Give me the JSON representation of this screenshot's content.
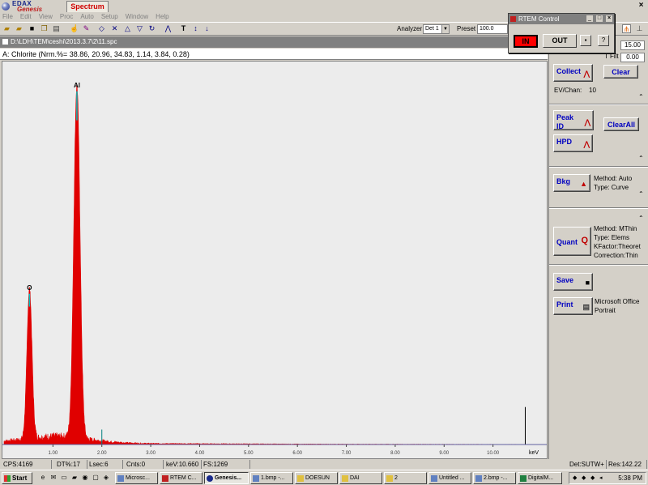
{
  "app": {
    "logo_top": "EDAX",
    "logo_bottom": "Genesis",
    "tab": "Spectrum",
    "close_glyph": "×"
  },
  "menu": [
    "File",
    "Edit",
    "View",
    "Proc",
    "Auto",
    "Setup",
    "Window",
    "Help"
  ],
  "toolbar": {
    "icons": [
      "open-icon",
      "import-icon",
      "save-icon",
      "copy-icon",
      "print-icon",
      "hand-icon",
      "marker-icon",
      "expand-h-icon",
      "contract-h-icon",
      "expand-v-icon",
      "contract-v-icon",
      "reset-icon",
      "peak-icon",
      "text-icon",
      "label-arrow-icon"
    ],
    "analyzer_label": "Analyzer",
    "analyzer_value": "Det 1",
    "preset_label": "Preset",
    "preset_value": "100.0"
  },
  "rtem": {
    "title": "RTEM Control",
    "in_label": "IN",
    "out_label": "OUT",
    "help_label": "?"
  },
  "document": {
    "path": "D:\\LDH\\TEM\\ceshi\\2013.3.7\\2\\11.spc",
    "label": "A: Chlorite (Nrm.%= 38.86, 20.96, 34.83, 1.14, 3.84, 0.28)"
  },
  "right_panel": {
    "top_field_1": "15.00",
    "top_field_label_2": "T Filt",
    "top_field_2": "0.00",
    "collect": "Collect",
    "clear": "Clear",
    "ev_chan_label": "EV/Chan:",
    "ev_chan_value": "10",
    "peak_id": "Peak ID",
    "clear_all": "ClearAll",
    "hpd": "HPD",
    "bkg": "Bkg",
    "bkg_method": "Method: Auto",
    "bkg_type": "Type: Curve",
    "quant": "Quant",
    "quant_method": "Method: MThin",
    "quant_type": "Type: Elems",
    "quant_kfactor": "KFactor:Theoret",
    "quant_correction": "Correction:Thin",
    "save": "Save",
    "print": "Print",
    "print_info_1": "Microsoft Office",
    "print_info_2": "Portrait"
  },
  "chart_data": {
    "type": "line",
    "xlabel": "keV",
    "xlim": [
      0,
      11.0
    ],
    "x_ticks": [
      "1.00",
      "2.00",
      "3.00",
      "4.00",
      "5.00",
      "6.00",
      "7.00",
      "8.00",
      "9.00",
      "10.00"
    ],
    "series": [
      {
        "name": "Chlorite",
        "color": "#e00000",
        "peaks": [
          {
            "element": "O",
            "kev": 0.52,
            "height": 0.4
          },
          {
            "element": "Al",
            "kev": 1.49,
            "height": 0.94
          }
        ]
      }
    ],
    "markers": [
      {
        "kev": 2.0,
        "height": 0.04,
        "color": "#008080"
      }
    ],
    "cursor_kev": 10.66,
    "full_scale": 1269
  },
  "status": {
    "cps": "CPS:4169",
    "dt": "DT%:17",
    "lsec": "Lsec:6",
    "cnts": "Cnts:0",
    "kev": "keV:10.660",
    "fs": "FS:1269",
    "det": "Det:SUTW+",
    "res": "Res:142.22"
  },
  "taskbar": {
    "start": "Start",
    "tasks": [
      "Microsc...",
      "RTEM C...",
      "Genesis...",
      "1.bmp -...",
      "DOESUN",
      "DAI",
      "2",
      "Untitled ...",
      "2.bmp -...",
      "DigitalM..."
    ],
    "clock": "5:38 PM"
  }
}
